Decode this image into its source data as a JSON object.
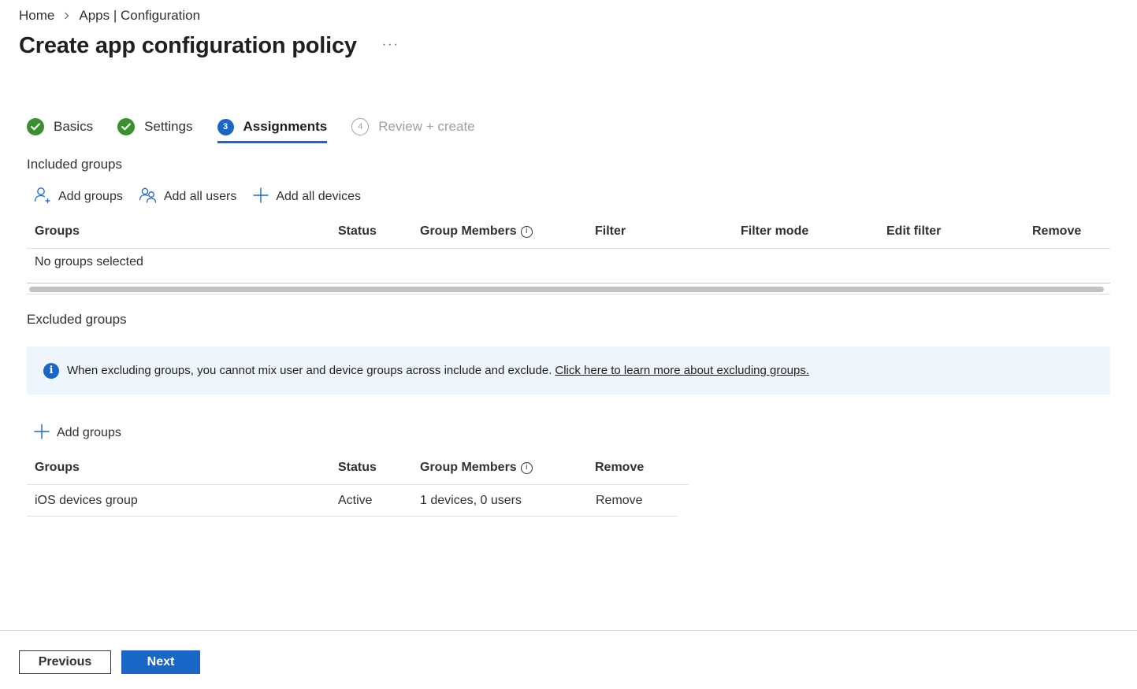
{
  "breadcrumb": {
    "items": [
      "Home",
      "Apps | Configuration"
    ]
  },
  "header": {
    "title": "Create app configuration policy",
    "more_label": "···"
  },
  "wizard": {
    "steps": [
      {
        "label": "Basics",
        "state": "done",
        "number": ""
      },
      {
        "label": "Settings",
        "state": "done",
        "number": ""
      },
      {
        "label": "Assignments",
        "state": "active",
        "number": "3"
      },
      {
        "label": "Review + create",
        "state": "pending",
        "number": "4"
      }
    ]
  },
  "included": {
    "heading": "Included groups",
    "commands": [
      {
        "label": "Add groups",
        "icon": "person-add-icon"
      },
      {
        "label": "Add all users",
        "icon": "people-icon"
      },
      {
        "label": "Add all devices",
        "icon": "plus-icon"
      }
    ],
    "columns": [
      "Groups",
      "Status",
      "Group Members",
      "Filter",
      "Filter mode",
      "Edit filter",
      "Remove"
    ],
    "empty_text": "No groups selected"
  },
  "excluded": {
    "heading": "Excluded groups",
    "banner_text": "When excluding groups, you cannot mix user and device groups across include and exclude.",
    "banner_link": "Click here to learn more about excluding groups.",
    "add_label": "Add groups",
    "columns": [
      "Groups",
      "Status",
      "Group Members",
      "Remove"
    ],
    "rows": [
      {
        "group": "iOS devices group",
        "status": "Active",
        "members": "1 devices, 0 users",
        "remove": "Remove"
      }
    ]
  },
  "footer": {
    "previous_label": "Previous",
    "next_label": "Next"
  },
  "colors": {
    "accent": "#1a66c7",
    "success": "#3a8f2e",
    "banner_bg": "#eff5fc"
  }
}
